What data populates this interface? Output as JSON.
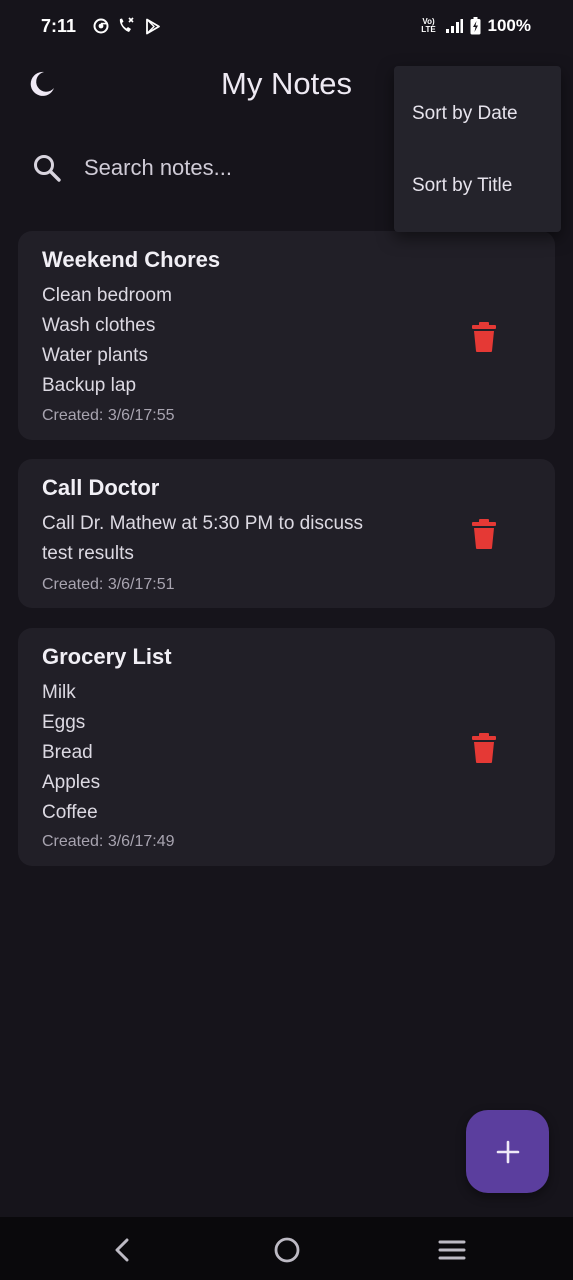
{
  "status_bar": {
    "time": "7:11",
    "network_label": "Vo) LTE",
    "battery": "100%",
    "icons": [
      "chrome-icon",
      "wifi-calling-icon",
      "play-store-icon",
      "volte-icon",
      "signal-icon",
      "battery-icon"
    ]
  },
  "app_bar": {
    "title": "My Notes",
    "theme_icon": "moon-icon"
  },
  "search": {
    "placeholder": "Search notes..."
  },
  "sort_menu": {
    "items": [
      "Sort by Date",
      "Sort by Title"
    ]
  },
  "notes": [
    {
      "title": "Weekend Chores",
      "lines": [
        "Clean bedroom",
        "Wash clothes",
        "Water plants",
        "Backup lap"
      ],
      "created": "Created: 3/6/17:55"
    },
    {
      "title": "Call Doctor",
      "lines": [
        "Call Dr. Mathew at 5:30 PM to discuss",
        "test results"
      ],
      "created": "Created: 3/6/17:51"
    },
    {
      "title": "Grocery List",
      "lines": [
        "Milk",
        "Eggs",
        "Bread",
        "Apples",
        "Coffee"
      ],
      "created": "Created: 3/6/17:49"
    }
  ],
  "fab": {
    "icon": "plus-icon"
  },
  "nav_bar": {
    "icons": [
      "back-icon",
      "home-icon",
      "recents-icon"
    ]
  },
  "colors": {
    "background": "#16141b",
    "card": "#211f27",
    "delete": "#e53935",
    "fab": "#5b3e9e",
    "menu": "#24232b"
  }
}
